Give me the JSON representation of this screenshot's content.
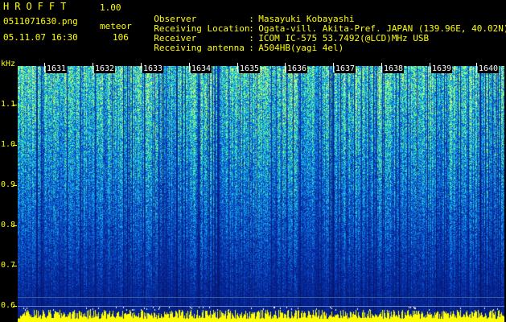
{
  "header": {
    "app_title": "HROFFT",
    "app_version": "1.00",
    "file_name": "0511071630.png",
    "mode": "meteor",
    "timestamp": "05.11.07 16:30",
    "count": "106"
  },
  "station": [
    {
      "label": "Observer",
      "value": "Masayuki Kobayashi"
    },
    {
      "label": "Receiving Location",
      "value": "Ogata-vill. Akita-Pref. JAPAN (139.96E, 40.02N)"
    },
    {
      "label": "Receiver",
      "value": "ICOM IC-575 53.7492(@LCD)MHz USB"
    },
    {
      "label": "Receiving antenna",
      "value": "A504HB(yagi 4el)"
    }
  ],
  "axis": {
    "unit": "kHz",
    "ticks": [
      "1.1",
      "1.0",
      "0.9",
      "0.8",
      "0.7",
      "0.6"
    ]
  },
  "time_labels": [
    "1631",
    "1632",
    "1633",
    "1634",
    "1635",
    "1636",
    "1637",
    "1638",
    "1639",
    "1640"
  ],
  "colors": {
    "text": "#ffff00",
    "background": "#000000",
    "signal_low": "#0a1a8a",
    "signal_mid": "#1060ff",
    "signal_high": "#30ffd0",
    "trace": "#ffff00"
  }
}
